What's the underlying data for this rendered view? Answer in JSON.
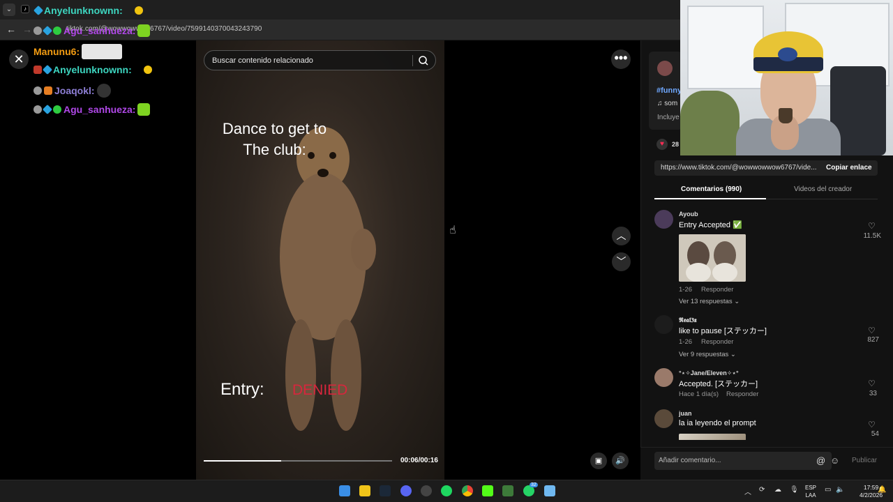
{
  "browser": {
    "url": "tiktok.com/@wowwowwow6767/video/7599140370043243790"
  },
  "chat": [
    {
      "user": "Anyelunknownn:",
      "color": "#3dd6c0",
      "emote_color": "#f1c40f"
    },
    {
      "user": "Agu_sanhueza:",
      "color": "#b048e8",
      "emote_color": "#7ed321"
    },
    {
      "user": "Manunu6:",
      "color": "#f39c12",
      "emote_color": "#e6e6e6"
    },
    {
      "user": "Anyelunknownn:",
      "color": "#3dd6c0",
      "emote_color": "#f1c40f"
    },
    {
      "user": "Joaqokl:",
      "color": "#8e7fd6",
      "emote_color": "#333"
    },
    {
      "user": "Agu_sanhueza:",
      "color": "#b048e8",
      "emote_color": "#7ed321"
    }
  ],
  "player": {
    "close_icon": "close-icon",
    "search_placeholder": "Buscar contenido relacionado",
    "caption_line1": "Dance to get to",
    "caption_line2": "The club:",
    "entry_label": "Entry:",
    "entry_status": "DENIED",
    "time": "00:06/00:16",
    "progress": 0.41
  },
  "details": {
    "hashtag": "#funny",
    "music": "♫  som",
    "incluye": "Incluye",
    "likes": "28",
    "link": "https://www.tiktok.com/@wowwowwow6767/vide...",
    "copy_label": "Copiar enlace",
    "tab_comments": "Comentarios (990)",
    "tab_videos": "Videos del creador"
  },
  "comments": [
    {
      "user": "Ayoub",
      "text": "Entry Accepted ✅",
      "date": "1-26",
      "reply": "Responder",
      "replies": "Ver 13 respuestas ⌄",
      "likes": "11.5K"
    },
    {
      "user": "𝕽𝖊𝖆𝖑𝟑𝖝",
      "text": "like to pause [ステッカー]",
      "date": "1-26",
      "reply": "Responder",
      "replies": "Ver 9 respuestas ⌄",
      "likes": "827"
    },
    {
      "user": "°⋆✧Jane/Eleven✧⋆°",
      "text": "Accepted. [ステッカー]",
      "date": "Hace 1 día(s)",
      "reply": "Responder",
      "likes": "33"
    },
    {
      "user": "juan",
      "text": "la ia leyendo el prompt",
      "likes": "54"
    }
  ],
  "composer": {
    "placeholder": "Añadir comentario...",
    "at": "@",
    "emoji": "☺",
    "publish": "Publicar"
  },
  "taskbar": {
    "lang_1": "ESP",
    "lang_2": "LAA",
    "time": "17:59",
    "date": "4/2/2026",
    "whatsapp_badge": "32"
  }
}
